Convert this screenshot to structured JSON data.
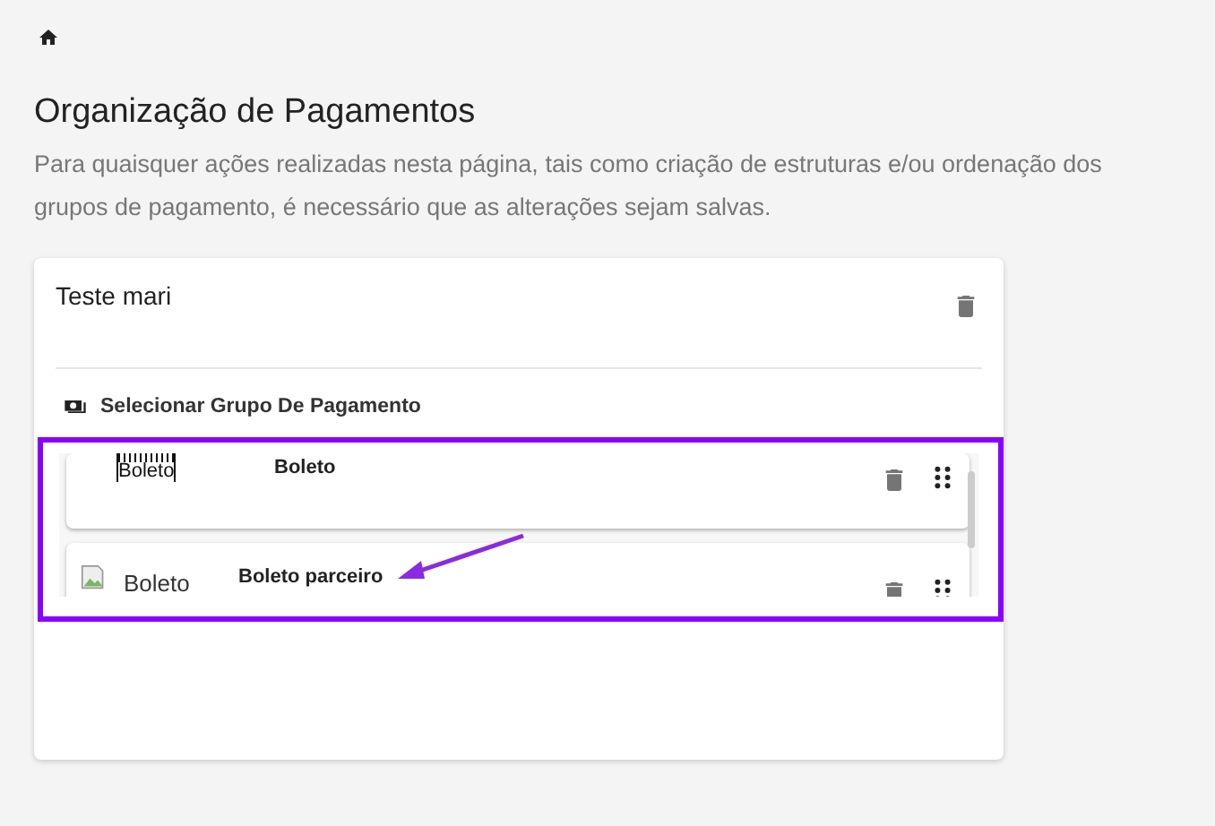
{
  "page": {
    "title": "Organização de Pagamentos",
    "description": "Para quaisquer ações realizadas nesta página, tais como criação de estruturas e/ou ordenação dos grupos de pagamento, é necessário que as alterações sejam salvas."
  },
  "group": {
    "name": "Teste mari",
    "select_label": "Selecionar Grupo De Pagamento",
    "methods": [
      {
        "kind": "barcode-logo",
        "logo_text": "Boleto",
        "name": "Boleto"
      },
      {
        "kind": "broken-image",
        "logo_text": "Boleto",
        "name": "Boleto parceiro"
      }
    ]
  }
}
